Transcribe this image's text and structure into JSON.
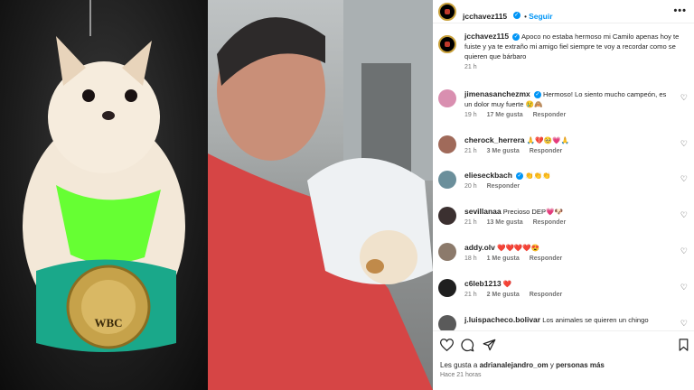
{
  "post": {
    "username": "jcchavez115",
    "follow_label": "Seguir",
    "more_label": "•••",
    "caption_text": "Apoco no estaba hermoso mi Camilo apenas hoy te fuiste y ya te extraño mi amigo fiel siempre te voy a recordar como se quieren que bárbaro",
    "caption_time": "21 h"
  },
  "media": {
    "belt_text": "WBC"
  },
  "comments": [
    {
      "user": "jimenasanchezmx",
      "verified": true,
      "text": "Hermoso! Lo siento mucho campeón, es un dolor muy fuerte 😢🙈",
      "time": "19 h",
      "likes": "17 Me gusta",
      "reply": "Responder"
    },
    {
      "user": "cherock_herrera",
      "verified": false,
      "text": "🙏💔🥺💗🙏",
      "time": "21 h",
      "likes": "3 Me gusta",
      "reply": "Responder"
    },
    {
      "user": "elieseckbach",
      "verified": true,
      "text": "👏👏👏",
      "time": "20 h",
      "likes": "",
      "reply": "Responder"
    },
    {
      "user": "sevillanaa",
      "verified": false,
      "text": "Precioso DEP💗🐶",
      "time": "21 h",
      "likes": "13 Me gusta",
      "reply": "Responder"
    },
    {
      "user": "addy.olv",
      "verified": false,
      "text": "❤️❤️❤️❤️😍",
      "time": "18 h",
      "likes": "1 Me gusta",
      "reply": "Responder"
    },
    {
      "user": "c6leb1213",
      "verified": false,
      "text": "❤️",
      "time": "21 h",
      "likes": "2 Me gusta",
      "reply": "Responder"
    },
    {
      "user": "j.luispacheco.bolivar",
      "verified": false,
      "text": "Los animales se quieren un chingo",
      "time": "",
      "likes": "",
      "reply": ""
    }
  ],
  "footer": {
    "likes_prefix": "Les gusta a ",
    "likes_user": "adrianalejandro_om",
    "likes_suffix": " y ",
    "likes_more": "personas más",
    "time_ago": "Hace 21 horas"
  },
  "icons": {
    "heart": "heart-icon",
    "comment": "comment-icon",
    "share": "share-icon",
    "save": "bookmark-icon"
  },
  "colors": {
    "link": "#0095f6",
    "belt": "#1aa88a",
    "bandana": "#66ff33",
    "shirt": "#d64545"
  }
}
